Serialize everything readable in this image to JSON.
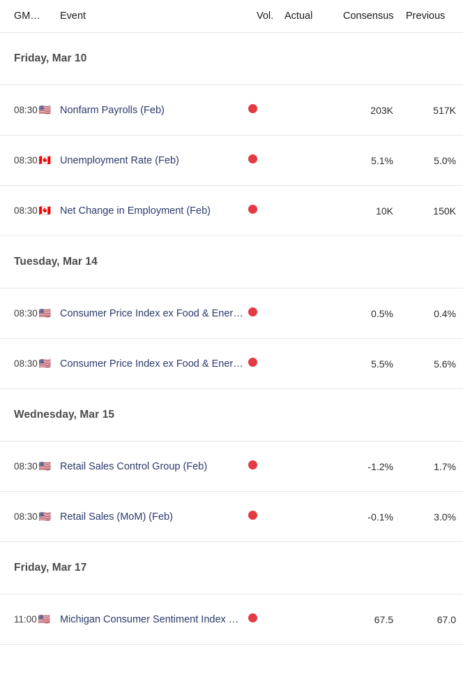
{
  "table": {
    "columns": {
      "time": "GM…",
      "event": "Event",
      "volatility": "Vol.",
      "actual": "Actual",
      "consensus": "Consensus",
      "previous": "Previous"
    }
  },
  "colors": {
    "volatility_high": "#e33b44",
    "event_link": "#2b3a6b",
    "row_border": "#e6e6e6",
    "date_header_text": "#4a4a4a"
  },
  "groups": [
    {
      "date": "Friday, Mar 10",
      "events": [
        {
          "time": "08:30",
          "flag": "us-flag-icon",
          "flag_glyph": "🇺🇸",
          "name": "Nonfarm Payrolls (Feb)",
          "volatility": "high",
          "actual": "",
          "consensus": "203K",
          "previous": "517K"
        },
        {
          "time": "08:30",
          "flag": "ca-flag-icon",
          "flag_glyph": "🇨🇦",
          "name": "Unemployment Rate (Feb)",
          "volatility": "high",
          "actual": "",
          "consensus": "5.1%",
          "previous": "5.0%"
        },
        {
          "time": "08:30",
          "flag": "ca-flag-icon",
          "flag_glyph": "🇨🇦",
          "name": "Net Change in Employment (Feb)",
          "volatility": "high",
          "actual": "",
          "consensus": "10K",
          "previous": "150K"
        }
      ]
    },
    {
      "date": "Tuesday, Mar 14",
      "events": [
        {
          "time": "08:30",
          "flag": "us-flag-icon",
          "flag_glyph": "🇺🇸",
          "name": "Consumer Price Index ex Food & Ener…",
          "volatility": "high",
          "actual": "",
          "consensus": "0.5%",
          "previous": "0.4%"
        },
        {
          "time": "08:30",
          "flag": "us-flag-icon",
          "flag_glyph": "🇺🇸",
          "name": "Consumer Price Index ex Food & Ener…",
          "volatility": "high",
          "actual": "",
          "consensus": "5.5%",
          "previous": "5.6%"
        }
      ]
    },
    {
      "date": "Wednesday, Mar 15",
      "events": [
        {
          "time": "08:30",
          "flag": "us-flag-icon",
          "flag_glyph": "🇺🇸",
          "name": "Retail Sales Control Group (Feb)",
          "volatility": "high",
          "actual": "",
          "consensus": "-1.2%",
          "previous": "1.7%"
        },
        {
          "time": "08:30",
          "flag": "us-flag-icon",
          "flag_glyph": "🇺🇸",
          "name": "Retail Sales (MoM) (Feb)",
          "volatility": "high",
          "actual": "",
          "consensus": "-0.1%",
          "previous": "3.0%"
        }
      ]
    },
    {
      "date": "Friday, Mar 17",
      "events": [
        {
          "time": "11:00",
          "flag": "us-flag-icon",
          "flag_glyph": "🇺🇸",
          "name": "Michigan Consumer Sentiment Index …",
          "volatility": "high",
          "actual": "",
          "consensus": "67.5",
          "previous": "67.0"
        }
      ]
    }
  ]
}
